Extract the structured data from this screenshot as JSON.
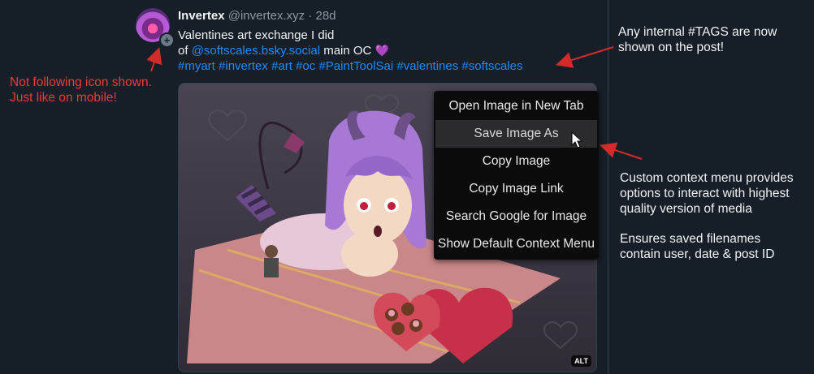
{
  "post": {
    "display_name": "Invertex",
    "handle": "@invertex.xyz",
    "separator": "·",
    "age": "28d",
    "text_line1": "Valentines art exchange I did",
    "text_of": "of",
    "mention": "@softscales.bsky.social",
    "text_after": "main OC",
    "emoji": "💜",
    "hashtags": [
      "#myart",
      "#invertex",
      "#art",
      "#oc",
      "#PaintToolSai",
      "#valentines",
      "#softscales"
    ],
    "alt_badge": "ALT",
    "follow_badge": "+"
  },
  "context_menu": {
    "items": [
      "Open Image in New Tab",
      "Save Image As",
      "Copy Image",
      "Copy Image Link",
      "Search Google for Image",
      "Show Default Context Menu"
    ],
    "hovered_item": "Save Image As"
  },
  "annotations": {
    "tags_note": [
      "Any internal #TAGS are now",
      "shown on the post!"
    ],
    "follow_note": [
      "Not following icon shown.",
      "Just like on mobile!"
    ],
    "menu_note": [
      "Custom context menu provides",
      "options to interact with highest",
      "quality version of media"
    ],
    "filename_note": [
      "Ensures saved filenames",
      "contain user, date & post ID"
    ]
  },
  "colors": {
    "background": "#161e27",
    "link": "#208bfe",
    "annotation_red": "#ee3a3a",
    "menu_bg": "#0b0b0c"
  }
}
